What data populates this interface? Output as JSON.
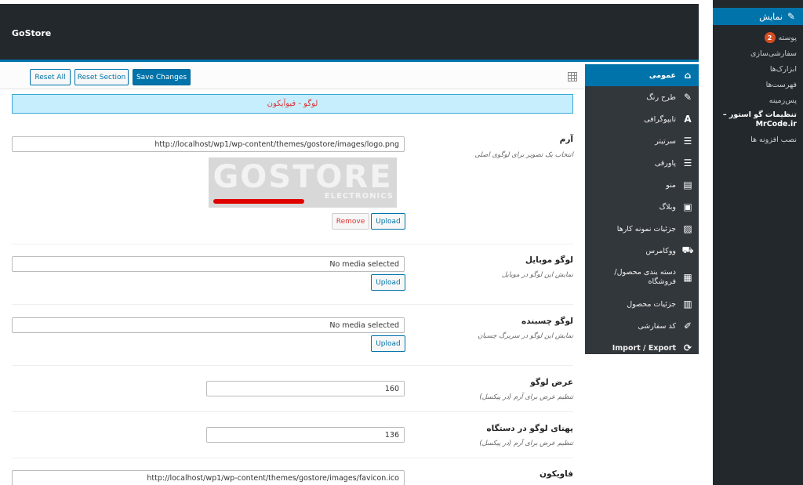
{
  "app": {
    "brand": "GoStore"
  },
  "wp_sidebar": {
    "current": "نمایش",
    "items": [
      {
        "label": "پوسته",
        "badge": "2"
      },
      {
        "label": "سفارشی‌سازی"
      },
      {
        "label": "ابزارک‌ها"
      },
      {
        "label": "فهرست‌ها"
      },
      {
        "label": "پس‌زمینه"
      },
      {
        "label": "تنظیمات گو استور – MrCode.ir"
      },
      {
        "label": "نصب افزونه ها"
      }
    ]
  },
  "toolbar": {
    "reset_all": "Reset All",
    "reset_section": "Reset Section",
    "save_changes": "Save Changes"
  },
  "nav": {
    "items": [
      {
        "label": "عمومی",
        "icon": "home-icon"
      },
      {
        "label": "طرح رنگ",
        "icon": "brush-icon"
      },
      {
        "label": "تایپوگرافی",
        "icon": "font-icon"
      },
      {
        "label": "سرتیتر",
        "icon": "menu-icon"
      },
      {
        "label": "پاورقی",
        "icon": "menu-icon"
      },
      {
        "label": "منو",
        "icon": "list-icon"
      },
      {
        "label": "وبلاگ",
        "icon": "blog-icon"
      },
      {
        "label": "جزئیات نمونه کارها",
        "icon": "image-icon"
      },
      {
        "label": "ووکامرس",
        "icon": "cart-icon"
      },
      {
        "label": "دسته بندی محصول/فروشگاه",
        "icon": "grid-icon"
      },
      {
        "label": "جزئیات محصول",
        "icon": "clipboard-icon"
      },
      {
        "label": "کد سفارشی",
        "icon": "edit-icon"
      },
      {
        "label": "Import / Export",
        "icon": "refresh-icon"
      }
    ]
  },
  "section": {
    "title": "لوگو - فیوآیکون"
  },
  "fields": {
    "logo": {
      "title": "آرم",
      "desc": "انتخاب یک تصویر برای لوگوی اصلی",
      "value": "http://localhost/wp1/wp-content/themes/gostore/images/logo.png",
      "preview_text": "GOSTORE",
      "preview_sub": "ELECTRONICS",
      "remove": "Remove",
      "upload": "Upload"
    },
    "mobile_logo": {
      "title": "لوگو موبایل",
      "desc": "نمایش این لوگو در موبایل",
      "value": "No media selected",
      "upload": "Upload"
    },
    "sticky_logo": {
      "title": "لوگو چسبنده",
      "desc": "نمایش این لوگو در سربرگ چسبان",
      "value": "No media selected",
      "upload": "Upload"
    },
    "logo_width": {
      "title": "عرض لوگو",
      "desc": "تنظیم عرض برای آرم (در پیکسل)",
      "value": "160"
    },
    "device_logo_width": {
      "title": "پهنای لوگو در دستگاه",
      "desc": "تنظیم عرض برای آرم (در پیکسل)",
      "value": "136"
    },
    "favicon": {
      "title": "فاویکون",
      "value": "http://localhost/wp1/wp-content/themes/gostore/images/favicon.ico"
    }
  },
  "colors": {
    "accent": "#0073aa",
    "dark": "#23282d",
    "banner_bg": "#c7eefc",
    "banner_text": "#dd3333"
  }
}
